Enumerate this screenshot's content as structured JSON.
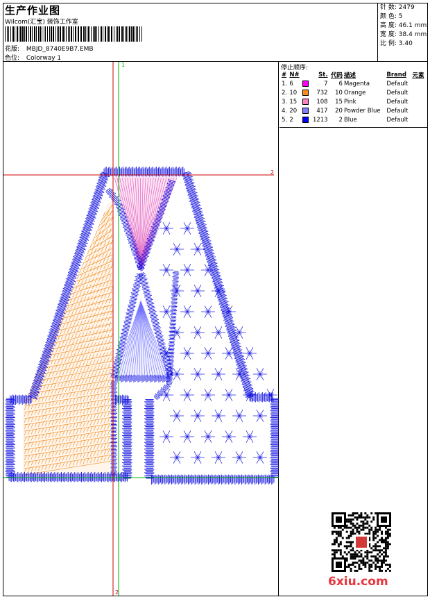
{
  "header": {
    "title": "生产作业图",
    "subtitle": "Wilcom(汇宝) 装饰工作室",
    "design_label": "花版:",
    "design_value": "MBJD_8740E9B7.EMB",
    "colorway_label": "色位:",
    "colorway_value": "Colorway 1"
  },
  "stats": [
    {
      "label": "针 数:",
      "value": "2479"
    },
    {
      "label": "颜 色:",
      "value": "5"
    },
    {
      "label": "高 度:",
      "value": "46.1 mm"
    },
    {
      "label": "宽 度:",
      "value": "38.4 mm"
    },
    {
      "label": "比 例:",
      "value": "3.40"
    }
  ],
  "stop_sequence": {
    "title": "停止顺序:",
    "headers": [
      "#",
      "N#",
      "St.",
      "代码",
      "描述",
      "Brand",
      "元素"
    ],
    "rows": [
      {
        "idx": "1.",
        "n": "6",
        "color": "#ff00ff",
        "st": "7",
        "code": "6",
        "desc": "Magenta",
        "brand": "Default"
      },
      {
        "idx": "2.",
        "n": "10",
        "color": "#ff8c1a",
        "st": "732",
        "code": "10",
        "desc": "Orange",
        "brand": "Default"
      },
      {
        "idx": "3.",
        "n": "15",
        "color": "#ff80c0",
        "st": "108",
        "code": "15",
        "desc": "Pink",
        "brand": "Default"
      },
      {
        "idx": "4.",
        "n": "20",
        "color": "#8080ff",
        "st": "417",
        "code": "20",
        "desc": "Powder Blue",
        "brand": "Default"
      },
      {
        "idx": "5.",
        "n": "2",
        "color": "#0000ff",
        "st": "1213",
        "code": "2",
        "desc": "Blue",
        "brand": "Default"
      }
    ]
  },
  "guides": {
    "v1": "1",
    "h2": "2",
    "v2": "2"
  },
  "watermark": "6xiu.com",
  "colors": {
    "blue": "#1010e0",
    "orange": "#f08a1e",
    "pink": "#e060c0",
    "powder": "#7070ff",
    "guide_red": "#cc0000",
    "guide_green": "#00b000"
  }
}
